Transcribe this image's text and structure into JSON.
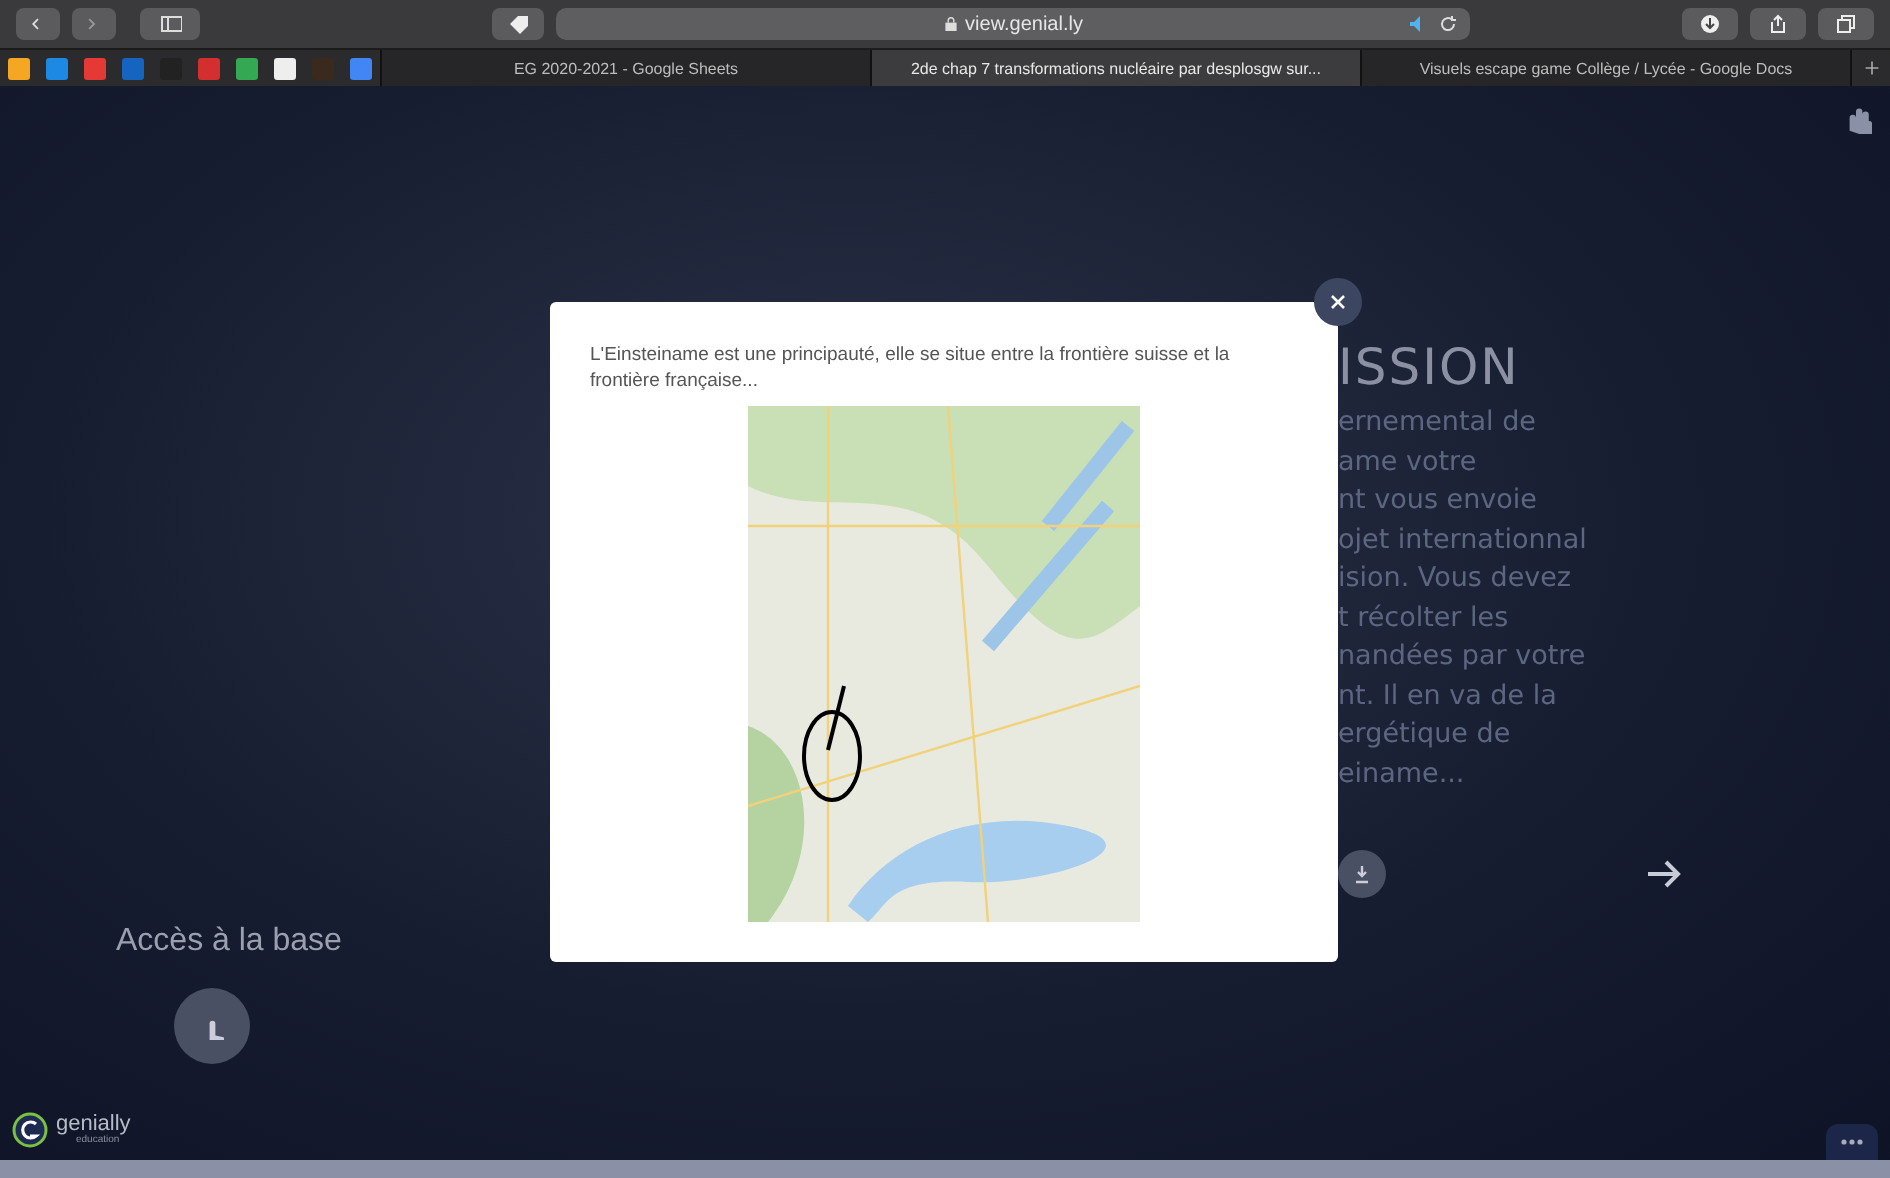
{
  "browser": {
    "url": "view.genial.ly"
  },
  "tabs": [
    {
      "label": "EG 2020-2021 - Google Sheets",
      "selected": false
    },
    {
      "label": "2de chap 7 transformations nucléaire par desplosgw sur...",
      "selected": true
    },
    {
      "label": "Visuels escape game Collège / Lycée - Google Docs",
      "selected": false
    }
  ],
  "slide": {
    "left_title": "Accès à la base",
    "mission_title": "ISSION",
    "mission_lines": [
      "ernemental de",
      "ame  votre",
      "nt vous envoie",
      "ojet internationnal",
      "ision. Vous devez",
      "t récolter les",
      "nandées par votre",
      "nt. Il en va de la",
      "ergétique de",
      "einame..."
    ]
  },
  "modal": {
    "text": "L'Einsteiname est une principauté, elle se situe entre la frontière suisse et la frontière française..."
  },
  "brand": {
    "name": "genially",
    "sub": "education"
  }
}
